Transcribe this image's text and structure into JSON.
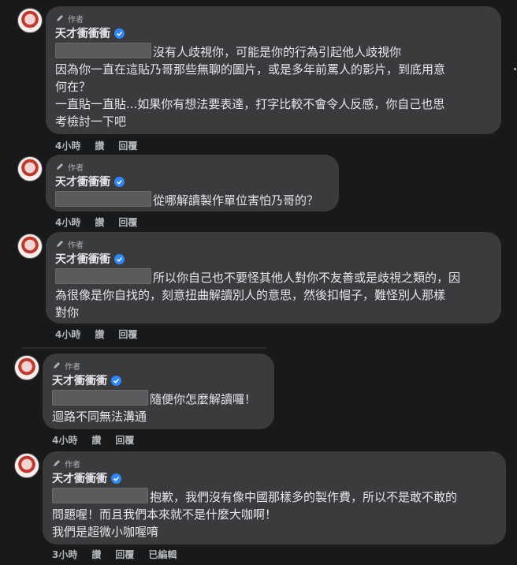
{
  "author_badge": "作者",
  "comments": [
    {
      "name": "天才衝衝衝",
      "lines": [
        "沒有人歧視你，可能是你的行為引起他人歧視你",
        "因為你一直在這貼乃哥那些無聊的圖片，或是多年前罵人的影片，到底用意",
        "何在？",
        "一直貼一直貼...如果你有想法要表達，打字比較不會令人反感，你自己也思",
        "考檢討一下吧"
      ],
      "time": "4小時",
      "like": "讚",
      "reply": "回覆"
    },
    {
      "name": "天才衝衝衝",
      "lines": [
        "從哪解讀製作單位害怕乃哥的？"
      ],
      "time": "4小時",
      "like": "讚",
      "reply": "回覆"
    },
    {
      "name": "天才衝衝衝",
      "lines": [
        "所以你自己也不要怪其他人對你不友善或是歧視之類的，因",
        "為很像是你自找的，刻意扭曲解讀別人的意思，然後扣帽子，難怪別人那樣",
        "對你"
      ],
      "time": "4小時",
      "like": "讚",
      "reply": "回覆"
    },
    {
      "name": "天才衝衝衝",
      "lines": [
        "隨便你怎麼解讀囉！",
        "迴路不同無法溝通"
      ],
      "time": "4小時",
      "like": "讚",
      "reply": "回覆"
    },
    {
      "name": "天才衝衝衝",
      "lines": [
        "抱歉，我們沒有像中國那樣多的製作費，所以不是敢不敢的",
        "問題喔！而且我們本來就不是什麼大咖啊！",
        "我們是超微小咖喔唷"
      ],
      "time": "3小時",
      "like": "讚",
      "reply": "回覆",
      "edited": "已編輯"
    }
  ]
}
